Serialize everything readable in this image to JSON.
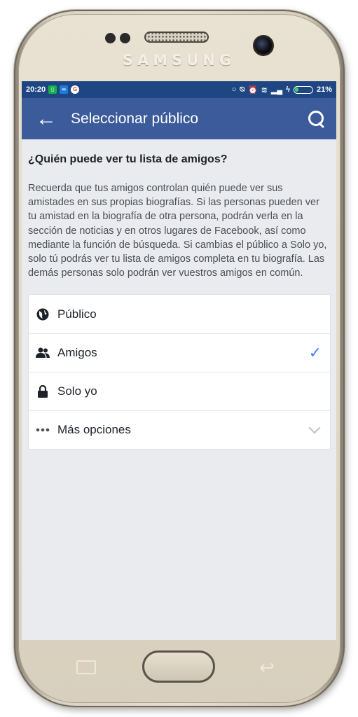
{
  "device": {
    "brand": "SAMSUNG"
  },
  "statusbar": {
    "time": "20:20",
    "battery": "21%"
  },
  "appbar": {
    "title": "Seleccionar público"
  },
  "content": {
    "question": "¿Quién puede ver tu lista de amigos?",
    "description": "Recuerda que tus amigos controlan quién puede ver sus amistades en sus propias biografías. Si las personas pueden ver tu amistad en la biografía de otra persona, podrán verla en la sección de noticias y en otros lugares de Facebook, así como mediante la función de búsqueda. Si cambias el público a Solo yo, solo tú podrás ver tu lista de amigos completa en tu biografía. Las demás personas solo podrán ver vuestros amigos en común."
  },
  "options": [
    {
      "label": "Público",
      "icon": "globe-icon",
      "selected": false
    },
    {
      "label": "Amigos",
      "icon": "friends-icon",
      "selected": true
    },
    {
      "label": "Solo yo",
      "icon": "lock-icon",
      "selected": false
    },
    {
      "label": "Más opciones",
      "icon": "more-dots-icon",
      "expandable": true
    }
  ],
  "colors": {
    "statusbar": "#1d4683",
    "appbar": "#3b5b9b",
    "check": "#4080ff",
    "background": "#e9ebee"
  }
}
